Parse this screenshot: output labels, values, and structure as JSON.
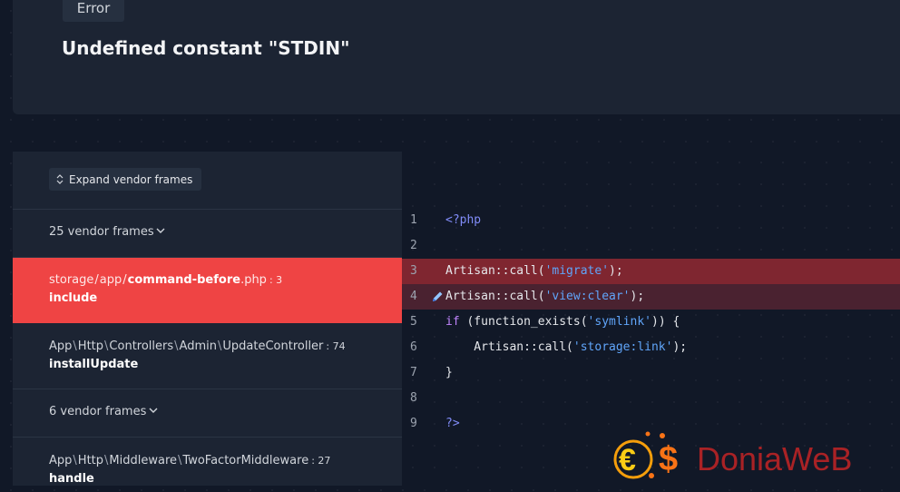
{
  "header": {
    "badge": "Error",
    "message": "Undefined constant \"STDIN\""
  },
  "trace": {
    "expand_label": "Expand vendor frames",
    "vendor_group_1": "25 vendor frames",
    "active_frame": {
      "path_1": "storage",
      "path_2": "app",
      "file": "command-before",
      "ext": ".php",
      "line": ": 3",
      "method": "include"
    },
    "frame_2": {
      "p1": "App",
      "p2": "Http",
      "p3": "Controllers",
      "p4": "Admin",
      "p5": "UpdateController",
      "line": ": 74",
      "method": "installUpdate"
    },
    "vendor_group_2": "6 vendor frames",
    "frame_3": {
      "p1": "App",
      "p2": "Http",
      "p3": "Middleware",
      "p4": "TwoFactorMiddleware",
      "line": ": 27",
      "method": "handle"
    }
  },
  "code": {
    "lines": [
      {
        "n": "1",
        "text": "<?php"
      },
      {
        "n": "2",
        "text": ""
      },
      {
        "n": "3",
        "pre": "Artisan::call(",
        "str": "'migrate'",
        "post": ");"
      },
      {
        "n": "4",
        "pre": "Artisan::call(",
        "str": "'view:clear'",
        "post": ");"
      },
      {
        "n": "5",
        "kw": "if",
        "pre": " (function_exists(",
        "str": "'symlink'",
        "post": ")) {"
      },
      {
        "n": "6",
        "pre": "    Artisan::call(",
        "str": "'storage:link'",
        "post": ");"
      },
      {
        "n": "7",
        "text": "}"
      },
      {
        "n": "8",
        "text": ""
      },
      {
        "n": "9",
        "text": "?>"
      }
    ]
  },
  "watermark": {
    "text": "DoniaWeB"
  },
  "colors": {
    "accent_red": "#ef4444",
    "highlight_line": "#7f2630",
    "string": "#60a5fa",
    "keyword": "#c084fc"
  }
}
